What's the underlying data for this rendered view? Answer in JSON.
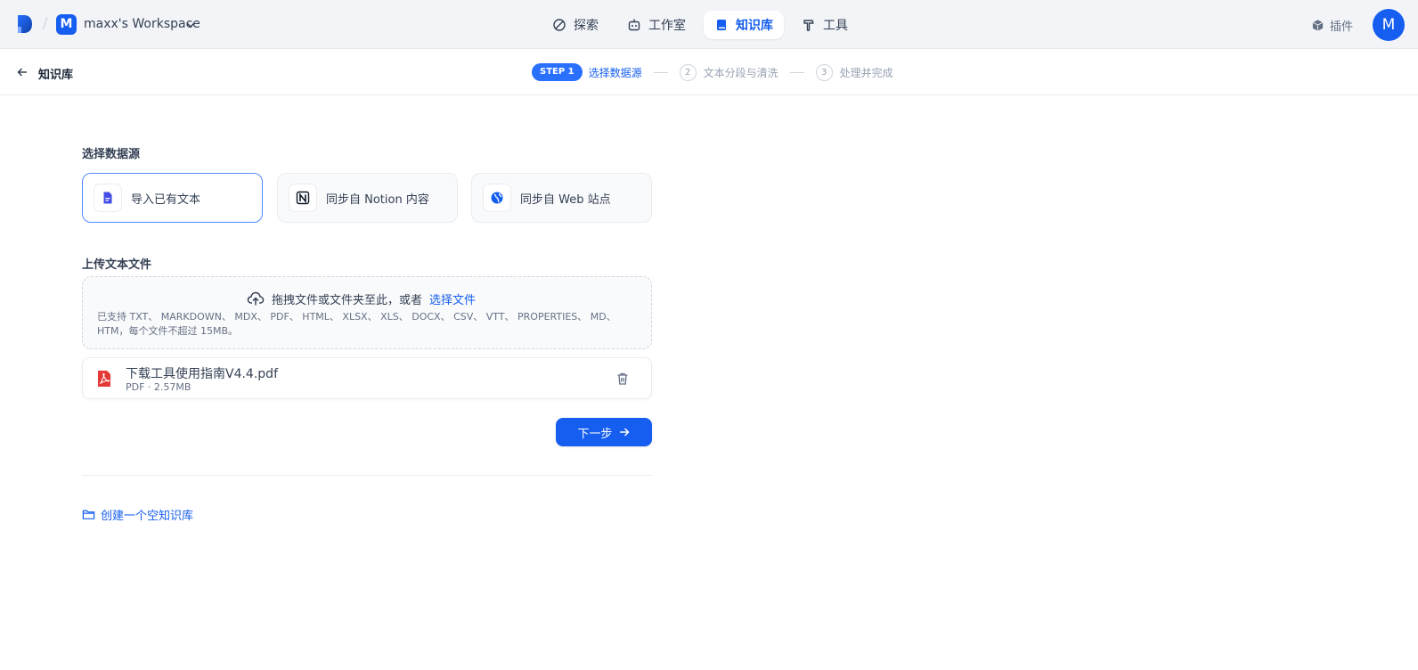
{
  "topbar": {
    "workspace_initial": "M",
    "workspace_name": "maxx's Workspace",
    "nav": [
      {
        "label": "探索",
        "icon": "compass-icon"
      },
      {
        "label": "工作室",
        "icon": "robot-icon"
      },
      {
        "label": "知识库",
        "icon": "book-icon",
        "active": true
      },
      {
        "label": "工具",
        "icon": "hammer-icon"
      }
    ],
    "plugin_label": "插件",
    "user_initial": "M"
  },
  "subheader": {
    "title": "知识库",
    "steps": {
      "step1_pill": "STEP 1",
      "step1_label": "选择数据源",
      "step2_num": "2",
      "step2_label": "文本分段与清洗",
      "step3_num": "3",
      "step3_label": "处理并完成"
    }
  },
  "main": {
    "source_title": "选择数据源",
    "sources": [
      {
        "label": "导入已有文本",
        "icon": "document-icon",
        "selected": true
      },
      {
        "label": "同步自 Notion 内容",
        "icon": "notion-icon"
      },
      {
        "label": "同步自 Web 站点",
        "icon": "web-icon"
      }
    ],
    "upload_title": "上传文本文件",
    "dropzone": {
      "text": "拖拽文件或文件夹至此，或者",
      "link": "选择文件",
      "tip": "已支持 TXT、 MARKDOWN、 MDX、 PDF、 HTML、 XLSX、 XLS、 DOCX、 CSV、 VTT、 PROPERTIES、 MD、 HTM，每个文件不超过 15MB。"
    },
    "file": {
      "name": "下载工具使用指南V4.4.pdf",
      "meta": "PDF · 2.57MB"
    },
    "next_button": "下一步",
    "create_empty": "创建一个空知识库"
  },
  "colors": {
    "accent": "#155eef",
    "step_pill": "#2970ff",
    "pdf_red": "#e53935"
  }
}
